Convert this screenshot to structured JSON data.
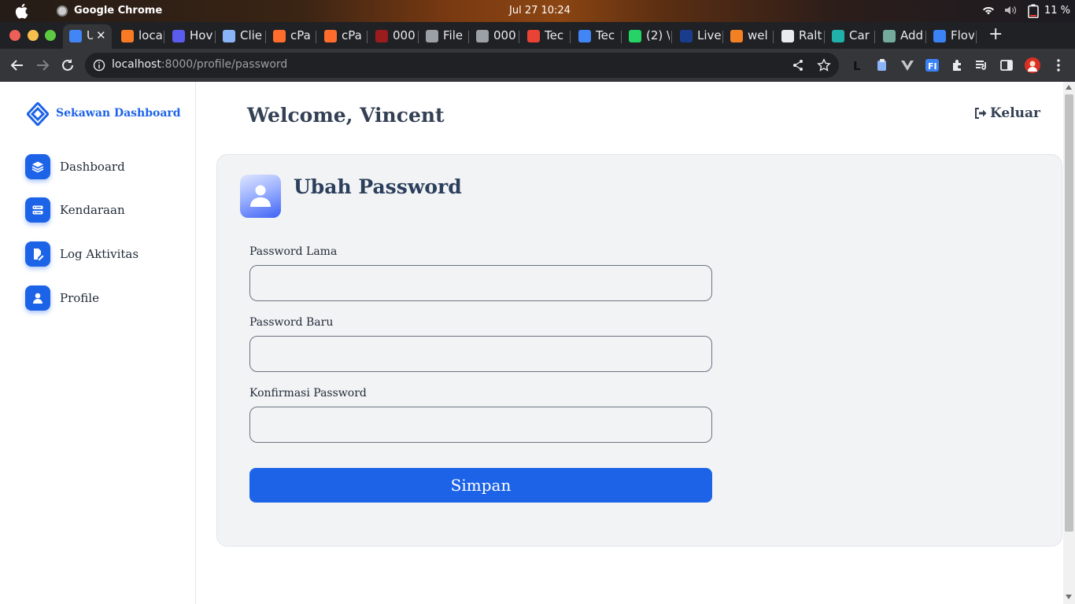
{
  "os": {
    "app_name": "Google Chrome",
    "clock": "Jul 27  10:24",
    "battery": "11 %"
  },
  "tabs": [
    {
      "title": "U",
      "icon": "sekawan-logo-icon",
      "color": "#4285f4",
      "active": true
    },
    {
      "title": "loca",
      "icon": "xampp-icon",
      "color": "#fb7a24"
    },
    {
      "title": "Hov",
      "icon": "terminal-icon",
      "color": "#5b5bf0"
    },
    {
      "title": "Clie",
      "icon": "home-icon",
      "color": "#8ab4f8"
    },
    {
      "title": "cPa",
      "icon": "cpanel-icon",
      "color": "#ff6c2c"
    },
    {
      "title": "cPa",
      "icon": "cpanel-icon",
      "color": "#ff6c2c"
    },
    {
      "title": "000",
      "icon": "webhost-icon",
      "color": "#9b1c1c"
    },
    {
      "title": "File",
      "icon": "globe-icon",
      "color": "#9aa0a6"
    },
    {
      "title": "000",
      "icon": "globe-icon",
      "color": "#9aa0a6"
    },
    {
      "title": "Tec",
      "icon": "gmail-icon",
      "color": "#ea4335"
    },
    {
      "title": "Tec",
      "icon": "docs-icon",
      "color": "#4285f4"
    },
    {
      "title": "(2) \\",
      "icon": "whatsapp-icon",
      "color": "#25d366"
    },
    {
      "title": "Live",
      "icon": "live-icon",
      "color": "#1a3c8c"
    },
    {
      "title": "wel",
      "icon": "stackoverflow-icon",
      "color": "#f48024"
    },
    {
      "title": "Ralt",
      "icon": "github-icon",
      "color": "#e8eaed"
    },
    {
      "title": "Car",
      "icon": "app-icon",
      "color": "#20b2aa"
    },
    {
      "title": "Add",
      "icon": "openai-icon",
      "color": "#74aa9c"
    },
    {
      "title": "Flov",
      "icon": "flow-icon",
      "color": "#3b82f6"
    }
  ],
  "browser": {
    "url_host": "localhost",
    "url_path": ":8000/profile/password"
  },
  "sidebar": {
    "brand": "Sekawan Dashboard",
    "items": [
      {
        "label": "Dashboard",
        "icon": "layers-icon"
      },
      {
        "label": "Kendaraan",
        "icon": "server-icon"
      },
      {
        "label": "Log Aktivitas",
        "icon": "file-edit-icon"
      },
      {
        "label": "Profile",
        "icon": "user-icon"
      }
    ]
  },
  "header": {
    "welcome": "Welcome, Vincent",
    "logout": "Keluar"
  },
  "form": {
    "title": "Ubah Password",
    "fields": [
      {
        "label": "Password Lama",
        "value": ""
      },
      {
        "label": "Password Baru",
        "value": ""
      },
      {
        "label": "Konfirmasi Password",
        "value": ""
      }
    ],
    "submit": "Simpan"
  },
  "colors": {
    "primary": "#1d63e8",
    "card_bg": "#f2f3f5",
    "heading": "#344054"
  }
}
